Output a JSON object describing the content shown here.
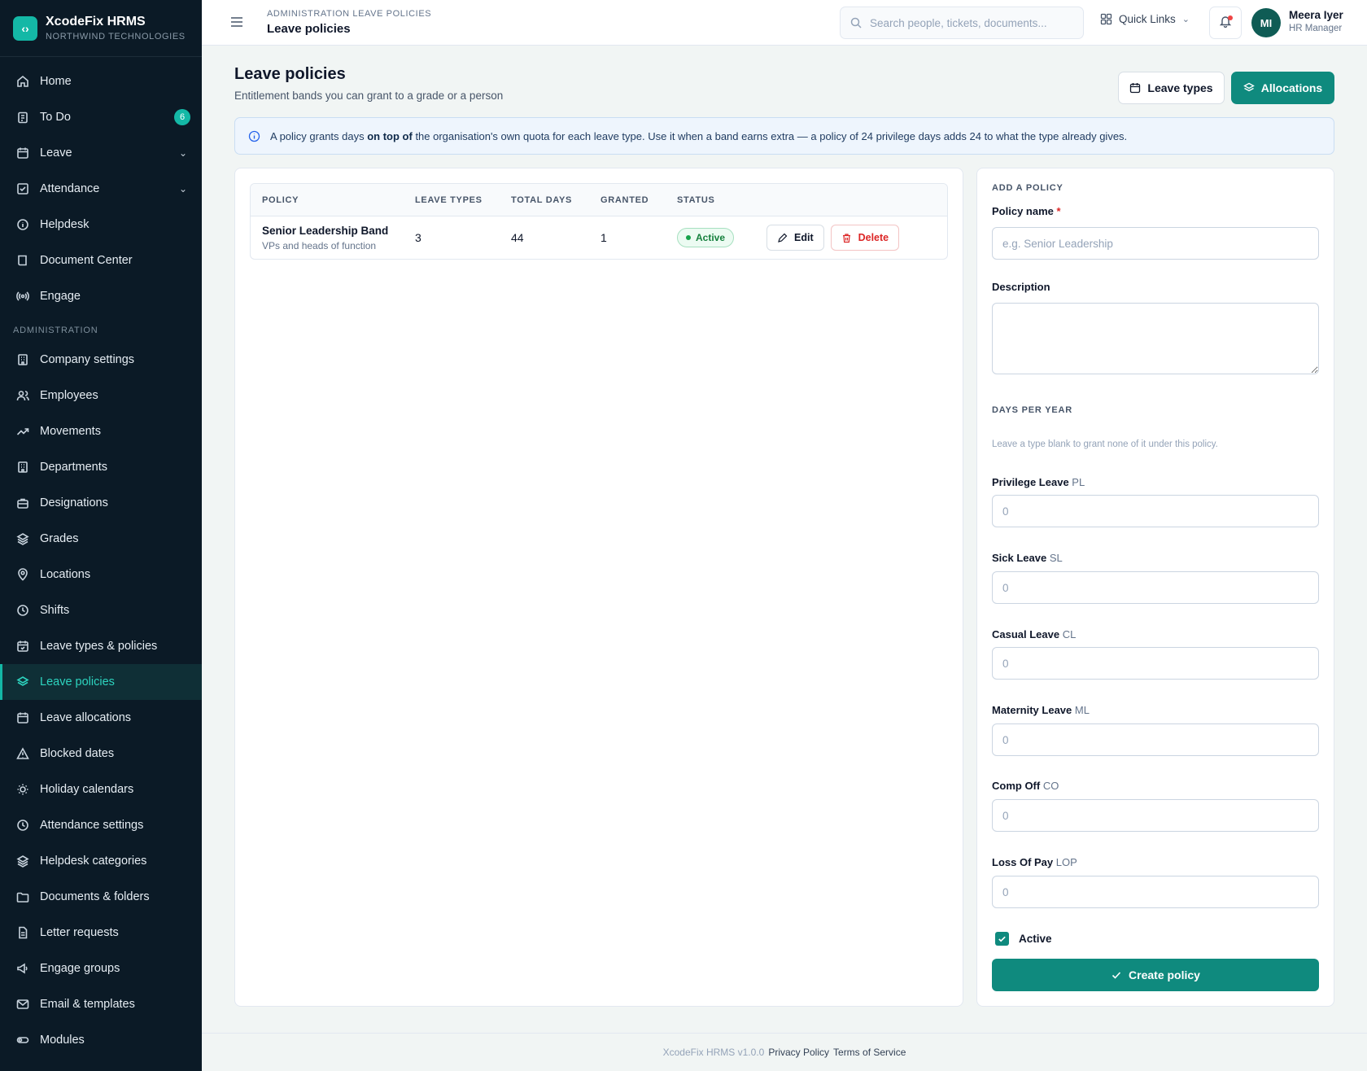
{
  "brand": {
    "name": "XcodeFix HRMS",
    "org": "NORTHWIND TECHNOLOGIES"
  },
  "sidebar": {
    "main_items": [
      {
        "label": "Home",
        "icon": "home-icon"
      },
      {
        "label": "To Do",
        "icon": "clipboard-icon",
        "badge": "6"
      },
      {
        "label": "Leave",
        "icon": "calendar-icon",
        "expandable": true
      },
      {
        "label": "Attendance",
        "icon": "check-square-icon",
        "expandable": true
      },
      {
        "label": "Helpdesk",
        "icon": "info-circle-icon"
      },
      {
        "label": "Document Center",
        "icon": "book-icon"
      },
      {
        "label": "Engage",
        "icon": "broadcast-icon"
      }
    ],
    "section_label": "ADMINISTRATION",
    "admin_items": [
      {
        "label": "Company settings",
        "icon": "building-icon"
      },
      {
        "label": "Employees",
        "icon": "users-icon"
      },
      {
        "label": "Movements",
        "icon": "trend-icon"
      },
      {
        "label": "Departments",
        "icon": "building-icon"
      },
      {
        "label": "Designations",
        "icon": "briefcase-icon"
      },
      {
        "label": "Grades",
        "icon": "layers-icon"
      },
      {
        "label": "Locations",
        "icon": "map-pin-icon"
      },
      {
        "label": "Shifts",
        "icon": "clock-icon"
      },
      {
        "label": "Leave types & policies",
        "icon": "calendar-check-icon"
      },
      {
        "label": "Leave policies",
        "icon": "layers-icon",
        "active": true
      },
      {
        "label": "Leave allocations",
        "icon": "calendar-icon"
      },
      {
        "label": "Blocked dates",
        "icon": "warning-icon"
      },
      {
        "label": "Holiday calendars",
        "icon": "sun-icon"
      },
      {
        "label": "Attendance settings",
        "icon": "clock-icon"
      },
      {
        "label": "Helpdesk categories",
        "icon": "layers-icon"
      },
      {
        "label": "Documents & folders",
        "icon": "folder-icon"
      },
      {
        "label": "Letter requests",
        "icon": "file-icon"
      },
      {
        "label": "Engage groups",
        "icon": "megaphone-icon"
      },
      {
        "label": "Email & templates",
        "icon": "mail-icon"
      },
      {
        "label": "Modules",
        "icon": "toggle-icon"
      }
    ]
  },
  "topbar": {
    "breadcrumb": "ADMINISTRATION LEAVE POLICIES",
    "title": "Leave policies",
    "search_placeholder": "Search people, tickets, documents...",
    "quick_links": "Quick Links",
    "user": {
      "initials": "MI",
      "name": "Meera Iyer",
      "role": "HR Manager"
    }
  },
  "page": {
    "title": "Leave policies",
    "subtitle": "Entitlement bands you can grant to a grade or a person",
    "btn_leave_types": "Leave types",
    "btn_allocations": "Allocations"
  },
  "info": {
    "pre": "A policy grants days ",
    "bold": "on top of",
    "post": " the organisation's own quota for each leave type. Use it when a band earns extra — a policy of 24 privilege days adds 24 to what the type already gives."
  },
  "table": {
    "headers": [
      "POLICY",
      "LEAVE TYPES",
      "TOTAL DAYS",
      "GRANTED",
      "STATUS"
    ],
    "rows": [
      {
        "name": "Senior Leadership Band",
        "description": "VPs and heads of function",
        "leave_types": "3",
        "total_days": "44",
        "granted": "1",
        "status": "Active",
        "edit": "Edit",
        "delete": "Delete"
      }
    ]
  },
  "form": {
    "heading": "ADD A POLICY",
    "name_label": "Policy name",
    "required_mark": "*",
    "name_placeholder": "e.g. Senior Leadership",
    "description_label": "Description",
    "days_heading": "DAYS PER YEAR",
    "days_hint": "Leave a type blank to grant none of it under this policy.",
    "types": [
      {
        "name": "Privilege Leave",
        "code": "PL",
        "placeholder": "0"
      },
      {
        "name": "Sick Leave",
        "code": "SL",
        "placeholder": "0"
      },
      {
        "name": "Casual Leave",
        "code": "CL",
        "placeholder": "0"
      },
      {
        "name": "Maternity Leave",
        "code": "ML",
        "placeholder": "0"
      },
      {
        "name": "Comp Off",
        "code": "CO",
        "placeholder": "0"
      },
      {
        "name": "Loss Of Pay",
        "code": "LOP",
        "placeholder": "0"
      }
    ],
    "active_label": "Active",
    "active_checked": true,
    "submit": "Create policy"
  },
  "footer": {
    "version": "XcodeFix HRMS v1.0.0",
    "privacy": "Privacy Policy",
    "terms": "Terms of Service"
  },
  "colors": {
    "accent": "#0f8a7e",
    "sidebar_bg": "#0b1a26",
    "active_text": "#2dd4bf"
  }
}
